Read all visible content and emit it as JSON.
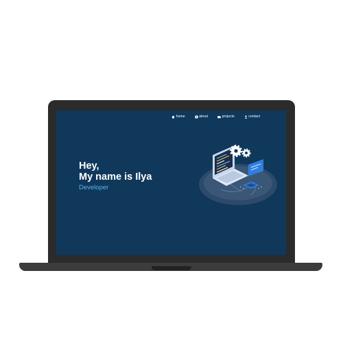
{
  "nav": {
    "items": [
      {
        "label": "home",
        "icon": "home-icon"
      },
      {
        "label": "about",
        "icon": "info-icon"
      },
      {
        "label": "projects",
        "icon": "folder-icon"
      },
      {
        "label": "contact",
        "icon": "user-icon"
      }
    ]
  },
  "hero": {
    "greeting": "Hey,",
    "name_line": "My name is Ilya",
    "role": "Developer"
  },
  "colors": {
    "screen_bg": "#0f385b",
    "accent": "#5bb4f5",
    "laptop_frame": "#2b2b2b"
  }
}
